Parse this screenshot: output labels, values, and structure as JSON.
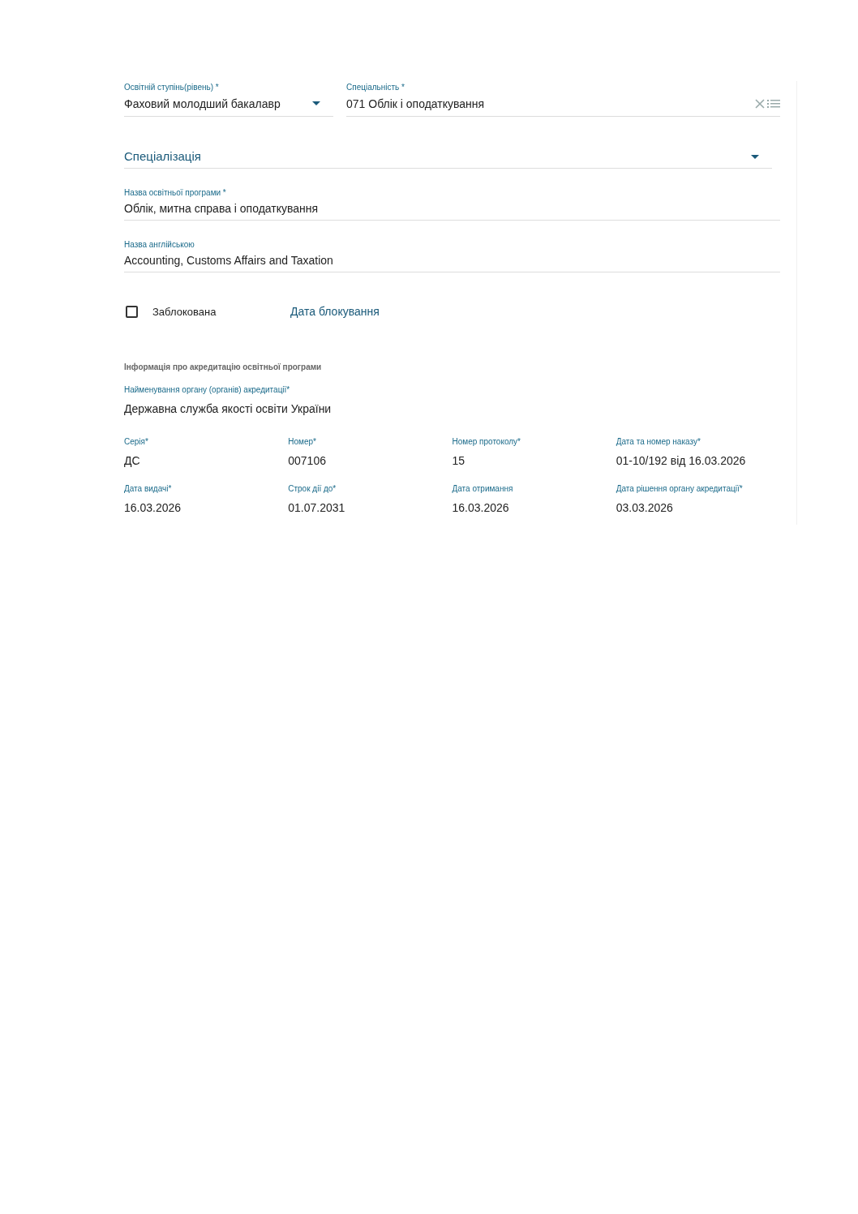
{
  "education_level": {
    "label": "Освітній ступінь(рівень) *",
    "value": "Фаховий молодший бакалавр"
  },
  "specialty": {
    "label": "Спеціальність *",
    "value": "071 Облік і оподаткування"
  },
  "specialization": {
    "placeholder": "Спеціалізація"
  },
  "program_name": {
    "label": "Назва освітньої програми *",
    "value": "Облік, митна справа і оподаткування"
  },
  "english_name": {
    "label": "Назва англійською",
    "value": "Accounting, Customs Affairs and Taxation"
  },
  "blocked": {
    "label": "Заблокована",
    "checked": false
  },
  "block_date": {
    "placeholder": "Дата блокування"
  },
  "accreditation": {
    "heading": "Інформація про акредитацію освітньої програми",
    "body": {
      "label": "Найменування органу (органів) акредитації*",
      "value": "Державна служба якості освіти України"
    },
    "fields": [
      {
        "label": "Серія*",
        "value": "ДС"
      },
      {
        "label": "Номер*",
        "value": "007106"
      },
      {
        "label": "Номер протоколу*",
        "value": "15"
      },
      {
        "label": "Дата та номер наказу*",
        "value": "01-10/192 від 16.03.2026"
      },
      {
        "label": "Дата видачі*",
        "value": "16.03.2026"
      },
      {
        "label": "Строк дії до*",
        "value": "01.07.2031"
      },
      {
        "label": "Дата отримання",
        "value": "16.03.2026"
      },
      {
        "label": "Дата рішення органу акредитації*",
        "value": "03.03.2026"
      }
    ]
  }
}
